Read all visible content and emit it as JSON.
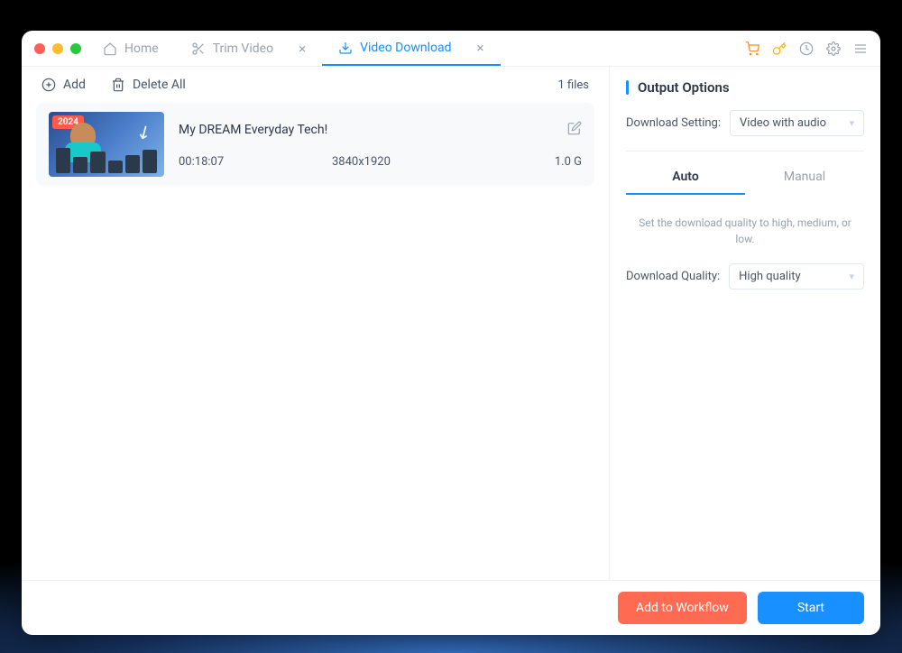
{
  "tabs": {
    "home": "Home",
    "trim": "Trim Video",
    "download": "Video Download"
  },
  "toolbar": {
    "add": "Add",
    "delete_all": "Delete All",
    "file_count": "1 files"
  },
  "file": {
    "title": "My DREAM Everyday Tech!",
    "duration": "00:18:07",
    "resolution": "3840x1920",
    "size": "1.0 G",
    "thumb_year": "2024"
  },
  "sidebar": {
    "title": "Output Options",
    "download_setting_label": "Download Setting:",
    "download_setting_value": "Video with audio",
    "tab_auto": "Auto",
    "tab_manual": "Manual",
    "hint": "Set the download quality to high, medium, or low.",
    "download_quality_label": "Download Quality:",
    "download_quality_value": "High quality"
  },
  "footer": {
    "workflow": "Add to Workflow",
    "start": "Start"
  }
}
